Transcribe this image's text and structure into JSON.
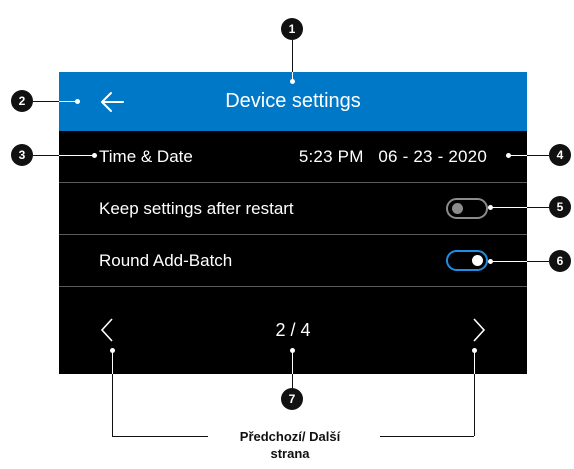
{
  "header": {
    "title": "Device settings",
    "back_icon": "arrow-left-icon"
  },
  "rows": {
    "time_date": {
      "label": "Time & Date",
      "value": "5:23 PM   06 - 23 - 2020"
    },
    "keep_settings": {
      "label": "Keep settings after restart",
      "toggle": "off"
    },
    "round_add_batch": {
      "label": "Round Add-Batch",
      "toggle": "on"
    }
  },
  "pager": {
    "text": "2 / 4",
    "prev_icon": "chevron-left-icon",
    "next_icon": "chevron-right-icon"
  },
  "callouts": [
    "1",
    "2",
    "3",
    "4",
    "5",
    "6",
    "7"
  ],
  "caption": "Předchozí/ Další\nstrana",
  "colors": {
    "header": "#0078c8",
    "screen": "#000000",
    "toggle_on": "#1e8fe0",
    "toggle_off": "#8c8c8c"
  }
}
